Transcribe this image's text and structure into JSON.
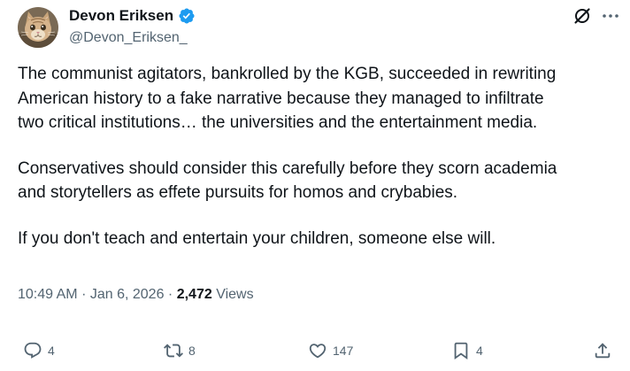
{
  "author": {
    "name": "Devon Eriksen",
    "handle": "@Devon_Eriksen_"
  },
  "post": {
    "paragraphs": [
      [
        "The communist agitators, bankrolled by the KGB, succeeded in rewriting",
        "American history to a fake narrative because they managed to infiltrate",
        "two critical institutions… the universities and the entertainment media."
      ],
      [
        "Conservatives should consider this carefully before they scorn academia",
        "and storytellers as effete pursuits for homos and crybabies."
      ],
      [
        "If you don't teach and entertain your children, someone else will."
      ]
    ]
  },
  "meta": {
    "time": "10:49 AM",
    "sep1": "·",
    "date": "Jan 6, 2026",
    "sep2": "·",
    "views_count": "2,472",
    "views_label": "Views"
  },
  "actions": {
    "replies": "4",
    "reposts": "8",
    "likes": "147",
    "bookmarks": "4"
  },
  "colors": {
    "text": "#0f1419",
    "secondary": "#536471",
    "verified": "#1d9bf0"
  },
  "icons": {
    "verified": "verified-badge-icon",
    "grok": "grok-icon",
    "more": "more-icon",
    "reply": "reply-icon",
    "repost": "repost-icon",
    "like": "like-icon",
    "bookmark": "bookmark-icon",
    "share": "share-icon"
  }
}
